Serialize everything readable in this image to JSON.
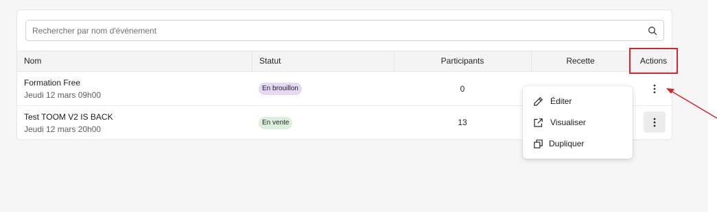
{
  "search": {
    "placeholder": "Rechercher par nom d'événement"
  },
  "table": {
    "headers": [
      "Nom",
      "Statut",
      "Participants",
      "Recette",
      "Actions"
    ],
    "rows": [
      {
        "name": "Formation Free",
        "date": "Jeudi 12 mars 09h00",
        "status": "En brouillon",
        "participants": "0"
      },
      {
        "name": "Test TOOM V2 IS BACK",
        "date": "Jeudi 12 mars 20h00",
        "status": "En vente",
        "participants": "13"
      }
    ]
  },
  "menu": {
    "items": [
      {
        "label": "Éditer",
        "icon": "pencil-icon"
      },
      {
        "label": "Visualiser",
        "icon": "external-link-icon"
      },
      {
        "label": "Dupliquer",
        "icon": "copy-icon"
      }
    ]
  },
  "colors": {
    "highlight": "#d9232a",
    "draft_badge": "#e5d8f3",
    "sale_badge": "#dcefdc"
  }
}
